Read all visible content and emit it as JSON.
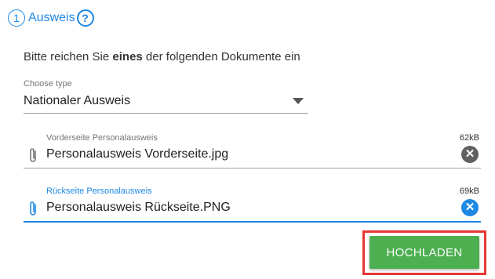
{
  "step": {
    "number": "1",
    "title": "Ausweis",
    "help": "?"
  },
  "instruction": {
    "before": "Bitte reichen Sie ",
    "bold": "eines",
    "after": " der folgenden Dokumente ein"
  },
  "document_type": {
    "label": "Choose type",
    "value": "Nationaler Ausweis"
  },
  "files": [
    {
      "label": "Vorderseite Personalausweis",
      "size": "62kB",
      "value": "Personalausweis Vorderseite.jpg"
    },
    {
      "label": "Rückseite Personalausweis",
      "size": "69kB",
      "value": "Personalausweis Rückseite.PNG"
    }
  ],
  "upload_button": {
    "label": "HOCHLADEN"
  },
  "colors": {
    "accent": "#1e88e5",
    "button": "#4caf50",
    "highlight_outline": "#e53935"
  }
}
